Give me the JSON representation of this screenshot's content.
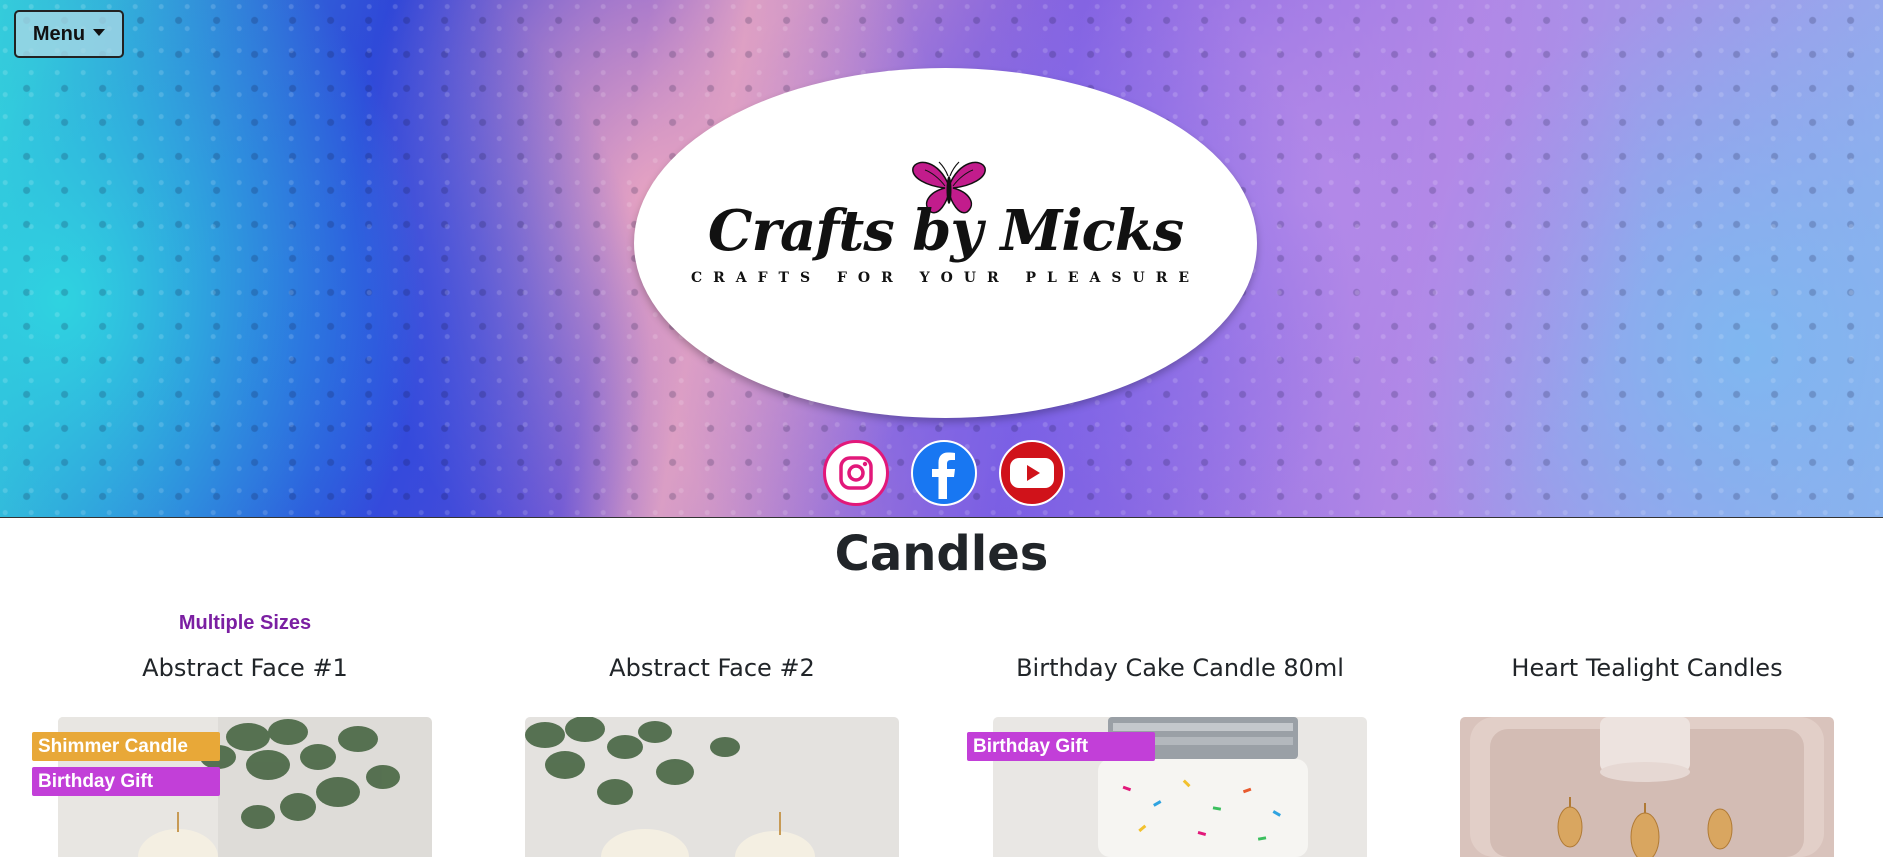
{
  "header": {
    "menu_label": "Menu",
    "logo_script": "Crafts by Micks",
    "logo_tagline": "CRAFTS FOR YOUR PLEASURE",
    "socials": [
      "instagram-icon",
      "facebook-icon",
      "youtube-icon"
    ]
  },
  "page": {
    "title": "Candles"
  },
  "products": [
    {
      "sizes_note": "Multiple Sizes",
      "name": "Abstract Face #1",
      "badges": [
        {
          "label": "Shimmer Candle",
          "color": "#e8a838"
        },
        {
          "label": "Birthday Gift",
          "color": "#c23fd8"
        }
      ]
    },
    {
      "sizes_note": "",
      "name": "Abstract Face #2",
      "badges": []
    },
    {
      "sizes_note": "",
      "name": "Birthday Cake Candle 80ml",
      "badges": [
        {
          "label": "Birthday Gift",
          "color": "#c23fd8"
        }
      ]
    },
    {
      "sizes_note": "",
      "name": "Heart Tealight Candles",
      "badges": []
    }
  ],
  "colors": {
    "sizes_note": "#7b1fa2",
    "shimmer_badge": "#e8a838",
    "birthday_badge": "#c23fd8",
    "instagram": "#e2187a",
    "facebook": "#1877f2",
    "youtube": "#d0121a"
  }
}
